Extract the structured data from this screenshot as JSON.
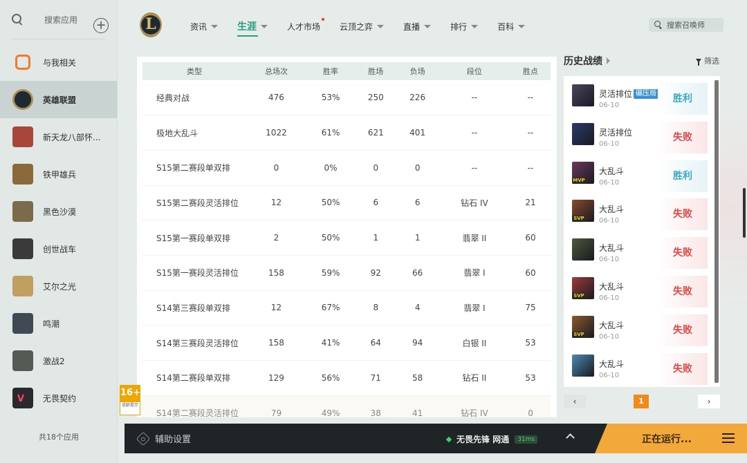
{
  "sidebar": {
    "search_label": "搜索应用",
    "items": [
      {
        "label": "与我相关",
        "icon": "related-icon",
        "color": "#f07a2a"
      },
      {
        "label": "英雄联盟",
        "icon": "lol-icon",
        "color": "#1d2a33"
      },
      {
        "label": "新天龙八部怀...",
        "icon": "tianlong-icon",
        "color": "#a8463a"
      },
      {
        "label": "铁甲雄兵",
        "icon": "tiejia-icon",
        "color": "#8a6a3a"
      },
      {
        "label": "黑色沙漠",
        "icon": "blackdesert-icon",
        "color": "#7a6b4a"
      },
      {
        "label": "创世战车",
        "icon": "chuangshi-icon",
        "color": "#3a3a3a"
      },
      {
        "label": "艾尔之光",
        "icon": "elsword-icon",
        "color": "#c0a060"
      },
      {
        "label": "鸣潮",
        "icon": "mingchao-icon",
        "color": "#3f4a55"
      },
      {
        "label": "激战2",
        "icon": "gw2-icon",
        "color": "#555a55"
      },
      {
        "label": "无畏契约",
        "icon": "valorant-icon",
        "color": "#c8374a"
      }
    ],
    "footer": "共18个应用"
  },
  "nav": {
    "items": [
      {
        "label": "资讯",
        "caret": true
      },
      {
        "label": "生涯",
        "caret": true,
        "active": true
      },
      {
        "label": "人才市场",
        "caret": false,
        "dot": true
      },
      {
        "label": "云顶之弈",
        "caret": true
      },
      {
        "label": "直播",
        "caret": true
      },
      {
        "label": "排行",
        "caret": true
      },
      {
        "label": "百科",
        "caret": true
      }
    ],
    "search_placeholder": "搜索召唤师"
  },
  "stats": {
    "headers": [
      "类型",
      "总场次",
      "胜率",
      "胜场",
      "负场",
      "段位",
      "胜点"
    ],
    "rows": [
      [
        "经典对战",
        "476",
        "53%",
        "250",
        "226",
        "--",
        "--"
      ],
      [
        "极地大乱斗",
        "1022",
        "61%",
        "621",
        "401",
        "--",
        "--"
      ],
      [
        "S15第二赛段单双排",
        "0",
        "0%",
        "0",
        "0",
        "--",
        "--"
      ],
      [
        "S15第二赛段灵活排位",
        "12",
        "50%",
        "6",
        "6",
        "钻石 IV",
        "21"
      ],
      [
        "S15第一赛段单双排",
        "2",
        "50%",
        "1",
        "1",
        "翡翠 II",
        "60"
      ],
      [
        "S15第一赛段灵活排位",
        "158",
        "59%",
        "92",
        "66",
        "翡翠 I",
        "60"
      ],
      [
        "S14第三赛段单双排",
        "12",
        "67%",
        "8",
        "4",
        "翡翠 I",
        "75"
      ],
      [
        "S14第三赛段灵活排位",
        "158",
        "41%",
        "64",
        "94",
        "白银 II",
        "53"
      ],
      [
        "S14第二赛段单双排",
        "129",
        "56%",
        "71",
        "58",
        "钻石 II",
        "53"
      ],
      [
        "S14第二赛段灵活排位",
        "79",
        "49%",
        "38",
        "41",
        "钻石 IV",
        "0"
      ]
    ]
  },
  "history": {
    "title": "历史战绩",
    "filter_label": "筛选",
    "matches": [
      {
        "mode": "灵活排位",
        "tag": "碾压局",
        "date": "06-10",
        "result": "胜利",
        "win": true,
        "badge": "",
        "champ_color": "#4a4560"
      },
      {
        "mode": "灵活排位",
        "tag": "",
        "date": "06-10",
        "result": "失败",
        "win": false,
        "badge": "",
        "champ_color": "#2a3a6a"
      },
      {
        "mode": "大乱斗",
        "tag": "",
        "date": "06-10",
        "result": "胜利",
        "win": true,
        "badge": "MVP",
        "champ_color": "#6a3a5a"
      },
      {
        "mode": "大乱斗",
        "tag": "",
        "date": "06-10",
        "result": "失败",
        "win": false,
        "badge": "SVP",
        "champ_color": "#8a4a2a"
      },
      {
        "mode": "大乱斗",
        "tag": "",
        "date": "06-10",
        "result": "失败",
        "win": false,
        "badge": "",
        "champ_color": "#4a5a3a"
      },
      {
        "mode": "大乱斗",
        "tag": "",
        "date": "06-10",
        "result": "失败",
        "win": false,
        "badge": "SVP",
        "champ_color": "#a03a3a"
      },
      {
        "mode": "大乱斗",
        "tag": "",
        "date": "06-10",
        "result": "失败",
        "win": false,
        "badge": "SVP",
        "champ_color": "#8a5a2a"
      },
      {
        "mode": "大乱斗",
        "tag": "",
        "date": "06-10",
        "result": "失败",
        "win": false,
        "badge": "",
        "champ_color": "#4a8ab0"
      }
    ],
    "page": "1"
  },
  "age_rating": {
    "num": "16+",
    "text": "适龄提示"
  },
  "bottom": {
    "assist_label": "辅助设置",
    "net_label": "无畏先锋 网通",
    "latency": "31ms",
    "running_label": "正在运行..."
  },
  "colors": {
    "accent": "#2a9d7e",
    "win": "#3ea6c7",
    "loss": "#e04848",
    "page_active": "#f08a1c",
    "running": "#f3a93a"
  }
}
